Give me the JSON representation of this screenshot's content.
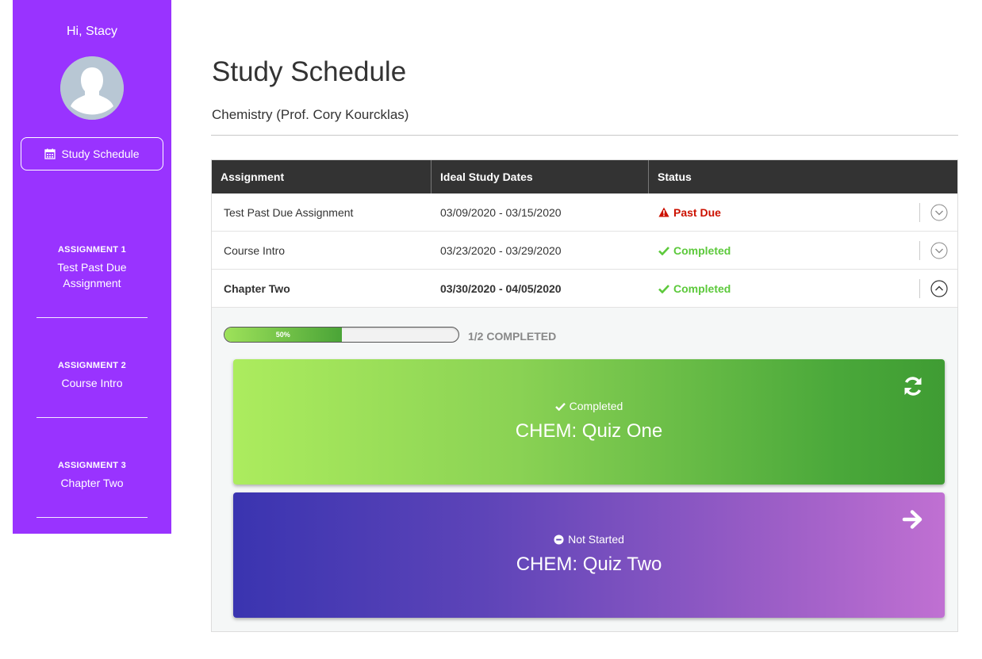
{
  "sidebar": {
    "greeting": "Hi, Stacy",
    "nav_button": {
      "label": "Study Schedule",
      "icon": "calendar-icon"
    },
    "assignments": [
      {
        "num": "ASSIGNMENT 1",
        "name": "Test Past Due Assignment"
      },
      {
        "num": "ASSIGNMENT 2",
        "name": "Course Intro"
      },
      {
        "num": "ASSIGNMENT 3",
        "name": "Chapter Two"
      }
    ],
    "bg_color": "#9933ff"
  },
  "main": {
    "title": "Study Schedule",
    "course": "Chemistry (Prof. Cory Kourcklas)"
  },
  "table": {
    "headers": [
      "Assignment",
      "Ideal Study Dates",
      "Status"
    ],
    "rows": [
      {
        "assignment": "Test Past Due Assignment",
        "dates": "03/09/2020 - 03/15/2020",
        "status": "Past Due",
        "status_icon": "warning-icon",
        "status_color": "#cc1100",
        "expanded": false
      },
      {
        "assignment": "Course Intro",
        "dates": "03/23/2020 - 03/29/2020",
        "status": "Completed",
        "status_icon": "check-icon",
        "status_color": "#5cc93b",
        "expanded": false
      },
      {
        "assignment": "Chapter Two",
        "dates": "03/30/2020 - 04/05/2020",
        "status": "Completed",
        "status_icon": "check-icon",
        "status_color": "#5cc93b",
        "expanded": true
      }
    ]
  },
  "expanded": {
    "progress_label": "50%",
    "progress_fraction": 0.5,
    "progress_text": "1/2 COMPLETED",
    "cards": [
      {
        "status": "Completed",
        "status_icon": "check-icon",
        "title": "CHEM: Quiz One",
        "action_icon": "refresh-icon"
      },
      {
        "status": "Not Started",
        "status_icon": "minus-circle-icon",
        "title": "CHEM: Quiz Two",
        "action_icon": "arrow-right-icon"
      }
    ]
  }
}
